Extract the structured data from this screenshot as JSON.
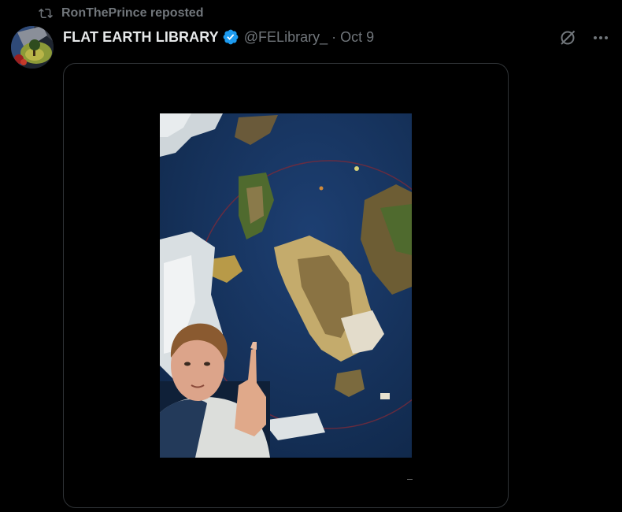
{
  "repost": {
    "text": "RonThePrince reposted",
    "icon": "repost-icon"
  },
  "author": {
    "display_name": "FLAT EARTH LIBRARY",
    "verified": true,
    "handle": "@FELibrary_",
    "separator": "·",
    "date": "Oct 9",
    "avatar_icon": "flat-earth-avatar"
  },
  "actions": {
    "grok_icon": "grok-icon",
    "more_icon": "more-icon"
  },
  "media": {
    "type": "video",
    "content": "fantasy-map-with-person-pointing-up"
  },
  "colors": {
    "background": "#000000",
    "primary_text": "#e7e9ea",
    "secondary_text": "#71767b",
    "verified_blue": "#1d9bf0",
    "card_border": "#2f3336"
  }
}
